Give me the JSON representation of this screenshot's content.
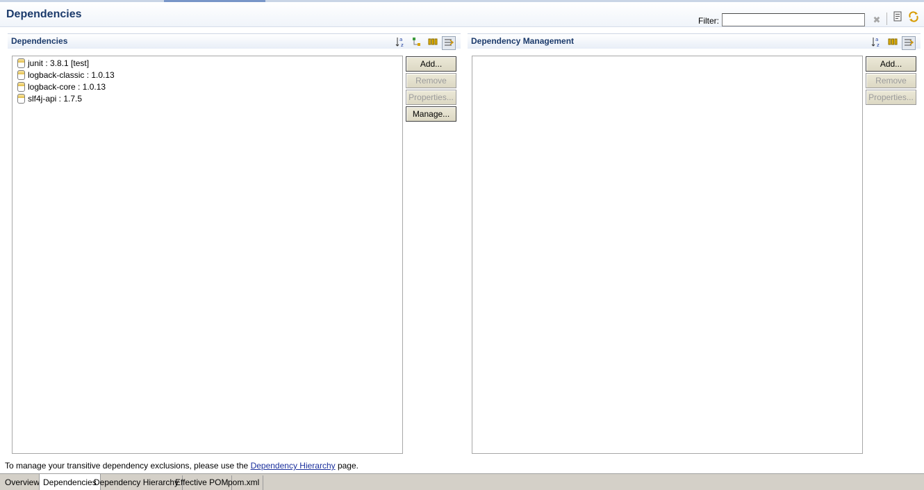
{
  "header": {
    "title": "Dependencies",
    "filter_label": "Filter:",
    "filter_value": "",
    "icons": [
      "clear-filter-icon",
      "save-pom-icon",
      "refresh-icon"
    ]
  },
  "dependencies_section": {
    "title": "Dependencies",
    "toolbar_icons": [
      "sort-alpha-icon",
      "show-groupid-icon",
      "columns-icon",
      "collapse-icon"
    ],
    "items": [
      {
        "label": "junit : 3.8.1 [test]"
      },
      {
        "label": "logback-classic : 1.0.13"
      },
      {
        "label": "logback-core : 1.0.13"
      },
      {
        "label": "slf4j-api : 1.7.5"
      }
    ],
    "buttons": {
      "add": "Add...",
      "remove": "Remove",
      "properties": "Properties...",
      "manage": "Manage..."
    }
  },
  "management_section": {
    "title": "Dependency Management",
    "toolbar_icons": [
      "sort-alpha-icon",
      "columns-icon",
      "collapse-icon"
    ],
    "items": [],
    "buttons": {
      "add": "Add...",
      "remove": "Remove",
      "properties": "Properties..."
    }
  },
  "footer": {
    "text_before": "To manage your transitive dependency exclusions, please use the ",
    "link": "Dependency Hierarchy",
    "text_after": " page."
  },
  "tabs": [
    {
      "label": "Overview",
      "active": false
    },
    {
      "label": "Dependencies",
      "active": true
    },
    {
      "label": "Dependency Hierarchy",
      "active": false
    },
    {
      "label": "Effective POM",
      "active": false
    },
    {
      "label": "pom.xml",
      "active": false
    }
  ]
}
